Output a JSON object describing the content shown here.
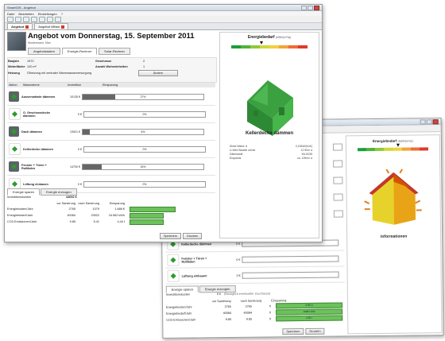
{
  "app_title": "SmartGIS - Angebot",
  "menu": [
    "Datei",
    "Bearbeiten",
    "Einstellungen",
    "?"
  ],
  "doc_tabs": [
    "Angebot",
    "Angebot öffnen"
  ],
  "offer_title": "Angebot vom Donnerstag, 15. September 2011",
  "offer_sub": "Mustermann, Max",
  "sub_tabs": [
    "Angebotsdaten",
    "Energie-Rechner",
    "Solar-Rechner"
  ],
  "building": {
    "baujahr_label": "Baujahr",
    "baujahr_value": "1970",
    "geschosse_label": "Geschosse",
    "geschosse_value": "2",
    "wohnflaeche_label": "Wohnfläche",
    "wohnflaeche_value": "120 m²",
    "wohneinheiten_label": "Anzahl Wohneinheiten",
    "wohneinheiten_value": "1",
    "heizung_label": "Heizung",
    "heizung_value": "Ölheizung mit zentraler Warmwasserversorgung",
    "change_button": "Ändern"
  },
  "measures_header": [
    "Aktion",
    "Massnahme",
    "Investition",
    "Einsparung"
  ],
  "measures": [
    {
      "name": "Aussenwände dämmen",
      "invest": "10135 €",
      "saving": "27%",
      "fraction": 0.27,
      "img": "dark"
    },
    {
      "name": "O. Geschossdecke dämmen",
      "invest": "0 €",
      "saving": "0%",
      "fraction": 0,
      "img": "light"
    },
    {
      "name": "Dach dämmen",
      "invest": "13921 €",
      "saving": "6%",
      "fraction": 0.06,
      "img": "dark"
    },
    {
      "name": "Kellerdecke dämmen",
      "invest": "0 €",
      "saving": "0%",
      "fraction": 0,
      "img": "light"
    },
    {
      "name": "Fenster + Türen + Rollläden",
      "invest": "14700 €",
      "saving": "16%",
      "fraction": 0.16,
      "img": "dark"
    },
    {
      "name": "Lüftung einbauen",
      "invest": "0 €",
      "saving": "0%",
      "fraction": 0,
      "img": "light"
    }
  ],
  "lower_tabs": [
    "Energie sparen",
    "Energie erzeugen"
  ],
  "invest_total_label": "Investitionskosten",
  "invest_total_value": "44692 €",
  "summary_header": [
    "vor Sanierung",
    "nach Sanierung",
    "Einsparung"
  ],
  "summary_rows": [
    {
      "label": "Energiekosten/Jahr",
      "before": "2765",
      "after": "1079",
      "saving": "1.686 €",
      "fraction": 0.62
    },
    {
      "label": "Energiebedarf/Jahr",
      "before": "40084",
      "after": "23522",
      "saving": "16.562 kWh",
      "fraction": 0.45
    },
    {
      "label": "CO2-Emissionen/Jahr",
      "before": "9.85",
      "after": "5.41",
      "saving": "4,44 t",
      "fraction": 0.45
    }
  ],
  "bottom_buttons": [
    "Speichern",
    "Drucken"
  ],
  "energy_title": "Energiebedarf",
  "energy_unit": "(kWh/(m²a))",
  "energy_scale_colors": [
    "#1e9e3a",
    "#4fb43a",
    "#8fc93a",
    "#cfd83a",
    "#f0d23a",
    "#f2a33a",
    "#ec6d33",
    "#e0392d"
  ],
  "energy_marker_position": 0.38,
  "right_caption": "Kellerdecke dämmen",
  "right_details": [
    {
      "label": "Dicke Wand: A",
      "value": "0,154W/(m²K)"
    },
    {
      "label": "U-Wert Bauteil vorher",
      "value": "12 €/m² a"
    },
    {
      "label": "Dämmstoff",
      "value": "WLG035"
    },
    {
      "label": "Ersparnis",
      "value": "ca. 12€/m² a"
    }
  ],
  "back_window": {
    "right_caption": "Informationen",
    "measures": [
      {
        "name": "Kellerdecke dämmen",
        "invest": "0 €"
      },
      {
        "name": "Fenster + Türen + Rollläden",
        "invest": "0 €"
      },
      {
        "name": "Lüftung einbauen",
        "invest": "0 €"
      }
    ],
    "lower_tabs": [
      "Energie sparen",
      "Energie erzeugen"
    ],
    "invest_label": "Investitionskosten",
    "invest_value": "0 €",
    "invest_note": "(Bezüglich eventueller Zuschüsse)",
    "summary_header": [
      "vor Sanierung",
      "nach Sanierung",
      "Einsparung"
    ],
    "summary_rows": [
      {
        "label": "Energiekosten/Jahr",
        "before": "2765",
        "after": "2765",
        "saving": "0",
        "bar": "2765 €"
      },
      {
        "label": "Energiebedarf/Jahr",
        "before": "40084",
        "after": "40084",
        "saving": "0",
        "bar": "40084 kWh"
      },
      {
        "label": "CO2-Emissionen/Jahr",
        "before": "9.85",
        "after": "9.85",
        "saving": "0",
        "bar": "9.85 t"
      }
    ],
    "buttons": [
      "Speichern",
      "Drucken"
    ]
  }
}
